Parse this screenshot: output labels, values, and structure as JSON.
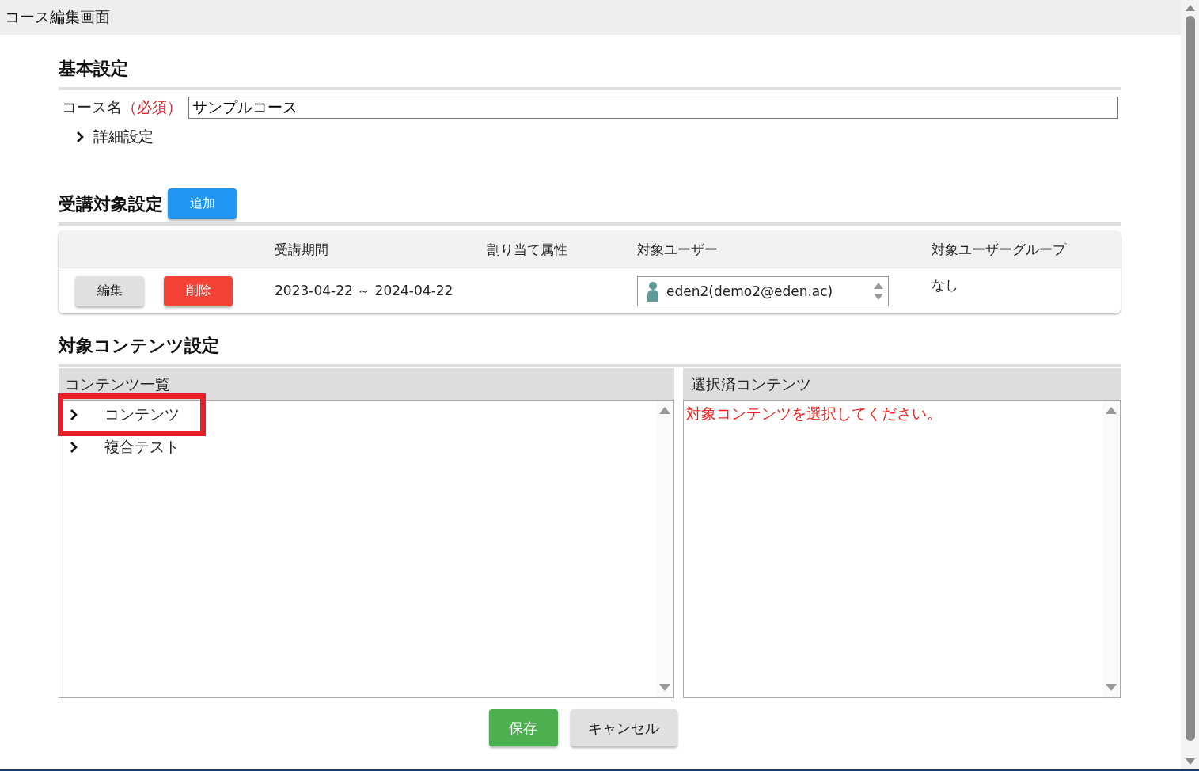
{
  "window": {
    "title": "コース編集画面"
  },
  "basic": {
    "heading": "基本設定",
    "course_name": {
      "label": "コース名",
      "required_mark": "（必須）",
      "value": "サンプルコース"
    },
    "details": {
      "label": "詳細設定",
      "expanded": false
    }
  },
  "target": {
    "heading": "受講対象設定",
    "add_button": {
      "label": "追加",
      "kind": "primary"
    },
    "columns": [
      "",
      "受講期間",
      "割り当て属性",
      "対象ユーザー",
      "対象ユーザーグループ"
    ],
    "rows": [
      {
        "buttons": [
          {
            "label": "編集",
            "kind": "default"
          },
          {
            "label": "削除",
            "kind": "danger"
          }
        ],
        "period": "2023-04-22 ～ 2024-04-22",
        "attribute": "",
        "users": [
          "eden2(demo2@eden.ac)"
        ],
        "groups": "なし"
      }
    ]
  },
  "contents": {
    "heading": "対象コンテンツ設定",
    "list": {
      "title": "コンテンツ一覧",
      "items": [
        {
          "label": "コンテンツ",
          "expanded": false,
          "highlighted": true
        },
        {
          "label": "複合テスト",
          "expanded": false,
          "highlighted": false
        }
      ]
    },
    "selected": {
      "title": "選択済コンテンツ",
      "message": "対象コンテンツを選択してください。"
    }
  },
  "actions": [
    {
      "label": "保存",
      "kind": "success"
    },
    {
      "label": "キャンセル",
      "kind": "default"
    }
  ]
}
